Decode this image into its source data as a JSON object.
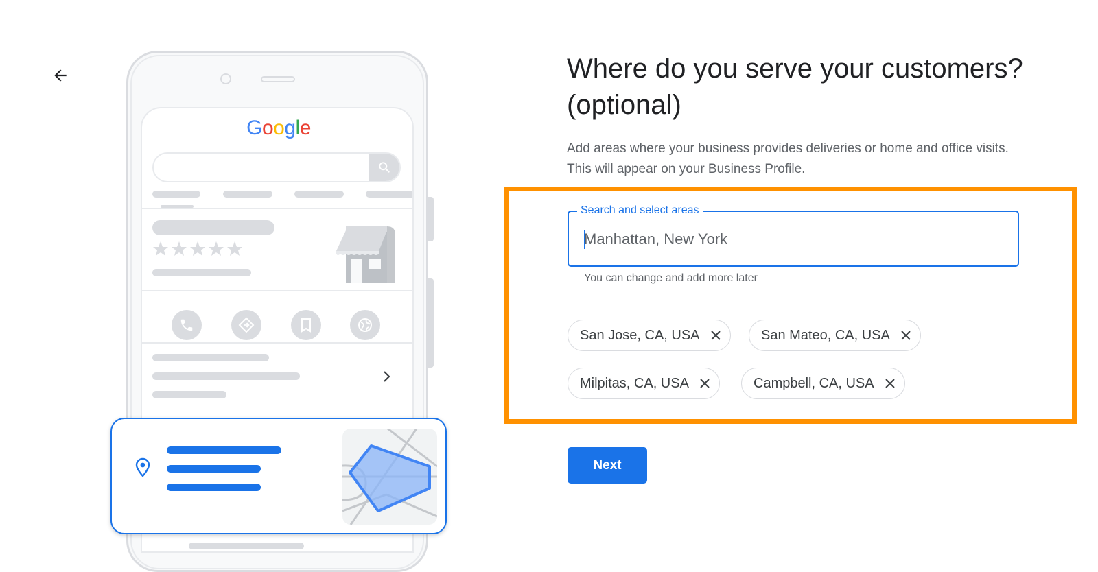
{
  "nav": {
    "back_icon": "arrow-left-icon",
    "back_label": "Back"
  },
  "illustration": {
    "logo_letters": [
      {
        "char": "G",
        "color": "#4285f4"
      },
      {
        "char": "o",
        "color": "#ea4335"
      },
      {
        "char": "o",
        "color": "#fbbc05"
      },
      {
        "char": "g",
        "color": "#4285f4"
      },
      {
        "char": "l",
        "color": "#34a853"
      },
      {
        "char": "e",
        "color": "#ea4335"
      }
    ],
    "rating_stars": 5,
    "action_icons": [
      "phone-icon",
      "directions-icon",
      "bookmark-icon",
      "globe-icon"
    ]
  },
  "page": {
    "title": "Where do you serve your customers? (optional)",
    "description": "Add areas where your business provides deliveries or home and office visits. This will appear on your Business Profile."
  },
  "search_field": {
    "label": "Search and select areas",
    "placeholder": "Manhattan, New York",
    "value": "",
    "helper": "You can change and add more later"
  },
  "selected_areas": [
    {
      "label": "San Jose, CA, USA"
    },
    {
      "label": "San Mateo, CA, USA"
    },
    {
      "label": "Milpitas, CA, USA"
    },
    {
      "label": "Campbell, CA, USA"
    }
  ],
  "actions": {
    "next_label": "Next"
  },
  "colors": {
    "accent": "#1a73e8",
    "highlight": "#ff9100",
    "chip_border": "#dadce0",
    "text_secondary": "#5f6368"
  }
}
